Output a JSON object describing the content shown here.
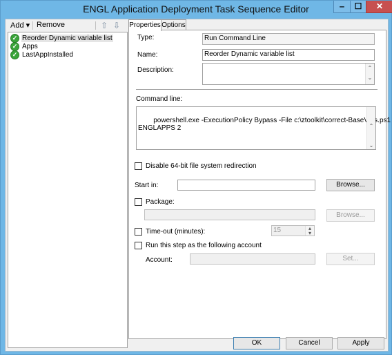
{
  "window": {
    "title": "ENGL Application Deployment Task Sequence Editor",
    "min_glyph": "‒",
    "max_glyph": "☐",
    "close_glyph": "✕"
  },
  "toolbar": {
    "add_label": "Add ▾",
    "remove_label": "Remove"
  },
  "tree": {
    "items": [
      {
        "label": "Reorder Dynamic variable list",
        "selected": true
      },
      {
        "label": "Apps"
      },
      {
        "label": "LastAppInstalled"
      }
    ]
  },
  "tabs": [
    {
      "label": "Properties",
      "active": true
    },
    {
      "label": "Options"
    }
  ],
  "properties": {
    "type_label": "Type:",
    "type_value": "Run Command Line",
    "name_label": "Name:",
    "name_value": "Reorder Dynamic variable list",
    "description_label": "Description:",
    "description_value": "",
    "command_line_label": "Command line:",
    "command_line_value": "powershell.exe -ExecutionPolicy Bypass -File c:\\ztoolkit\\correct-BaseVars.ps1\nENGLAPPS 2",
    "disable64_label": "Disable 64-bit file system redirection",
    "start_in_label": "Start in:",
    "start_in_value": "",
    "browse_label": "Browse...",
    "package_label": "Package:",
    "package_value": "",
    "package_browse_label": "Browse...",
    "timeout_label": "Time-out (minutes):",
    "timeout_value": "15",
    "run_as_label": "Run this step as the following account",
    "account_label": "Account:",
    "account_value": "",
    "set_label": "Set..."
  },
  "footer": {
    "ok_label": "OK",
    "cancel_label": "Cancel",
    "apply_label": "Apply"
  }
}
